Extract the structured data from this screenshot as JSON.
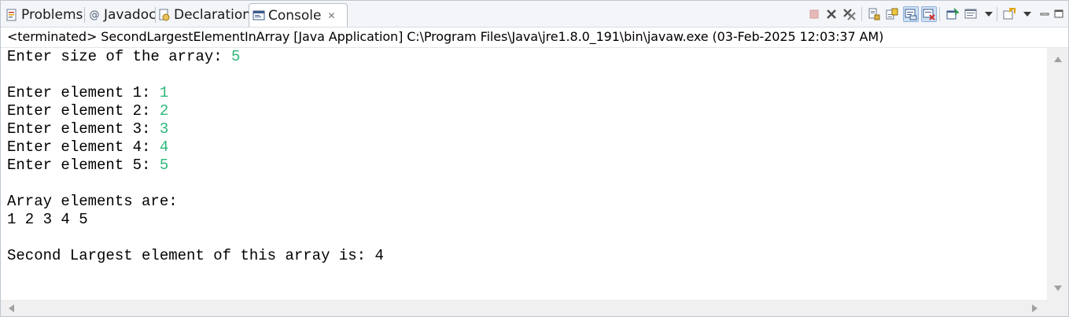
{
  "tabs": [
    {
      "label": "Problems",
      "icon": "problems-icon"
    },
    {
      "label": "Javadoc",
      "icon": "at-icon"
    },
    {
      "label": "Declaration",
      "icon": "declaration-icon"
    },
    {
      "label": "Console",
      "icon": "console-icon",
      "active": true
    }
  ],
  "toolbar_icons": [
    "terminate-icon",
    "remove-launch-icon",
    "remove-all-terminated-icon",
    "scroll-lock-icon",
    "word-wrap-icon",
    "show-console-on-stdout-icon",
    "show-console-on-stderr-icon",
    "pin-console-icon",
    "display-selected-console-icon",
    "view-menu-icon",
    "open-console-icon",
    "open-console-menu-icon",
    "minimize-icon",
    "maximize-icon"
  ],
  "status_line": "<terminated> SecondLargestElementInArray [Java Application] C:\\Program Files\\Java\\jre1.8.0_191\\bin\\javaw.exe (03-Feb-2025 12:03:37 AM)",
  "console": {
    "lines": [
      {
        "text": "Enter size of the array: ",
        "input": "5"
      },
      {
        "text": "",
        "input": ""
      },
      {
        "text": "Enter element 1: ",
        "input": "1"
      },
      {
        "text": "Enter element 2: ",
        "input": "2"
      },
      {
        "text": "Enter element 3: ",
        "input": "3"
      },
      {
        "text": "Enter element 4: ",
        "input": "4"
      },
      {
        "text": "Enter element 5: ",
        "input": "5"
      },
      {
        "text": "",
        "input": ""
      },
      {
        "text": "Array elements are:",
        "input": ""
      },
      {
        "text": "1 2 3 4 5",
        "input": ""
      },
      {
        "text": "",
        "input": ""
      },
      {
        "text": "Second Largest element of this array is: 4",
        "input": ""
      }
    ]
  },
  "colors": {
    "input_text": "#2db77a",
    "tab_bar": "#f3f5f8",
    "scrollbar": "#f0f0f0"
  }
}
